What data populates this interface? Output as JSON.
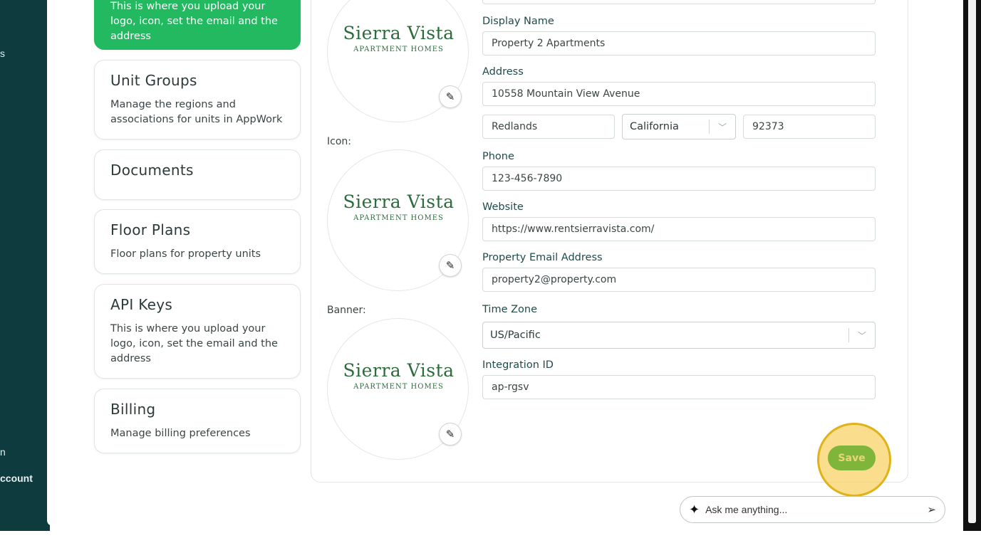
{
  "sidebar": {
    "frag_top": "s",
    "frag_mid": "n",
    "frag_account": "ccount"
  },
  "cards": [
    {
      "title": "",
      "desc": "This is where you upload your logo, icon, set the email and the address",
      "active": true
    },
    {
      "title": "Unit Groups",
      "desc": "Manage the regions and associations for units in AppWork"
    },
    {
      "title": "Documents",
      "desc": ""
    },
    {
      "title": "Floor Plans",
      "desc": "Floor plans for property units"
    },
    {
      "title": "API Keys",
      "desc": "This is where you upload your logo, icon, set the email and the address"
    },
    {
      "title": "Billing",
      "desc": "Manage billing preferences"
    }
  ],
  "images": {
    "icon_label": "Icon:",
    "banner_label": "Banner:",
    "brand_main": "Sierra Vista",
    "brand_sub": "APARTMENT HOMES"
  },
  "form": {
    "display_name_label": "Display Name",
    "display_name": "Property 2 Apartments",
    "address_label": "Address",
    "street": "10558 Mountain View Avenue",
    "city": "Redlands",
    "state": "California",
    "zip": "92373",
    "phone_label": "Phone",
    "phone": "123-456-7890",
    "website_label": "Website",
    "website": "https://www.rentsierravista.com/",
    "email_label": "Property Email Address",
    "email": "property2@property.com",
    "timezone_label": "Time Zone",
    "timezone": "US/Pacific",
    "integration_label": "Integration ID",
    "integration_id": "ap-rgsv"
  },
  "actions": {
    "save_label": "Save"
  },
  "assistant": {
    "placeholder": "Ask me anything..."
  },
  "icons": {
    "edit": "pencil-icon",
    "chevron": "chevron-down-icon",
    "sparkle": "sparkle-icon",
    "send": "send-icon"
  }
}
